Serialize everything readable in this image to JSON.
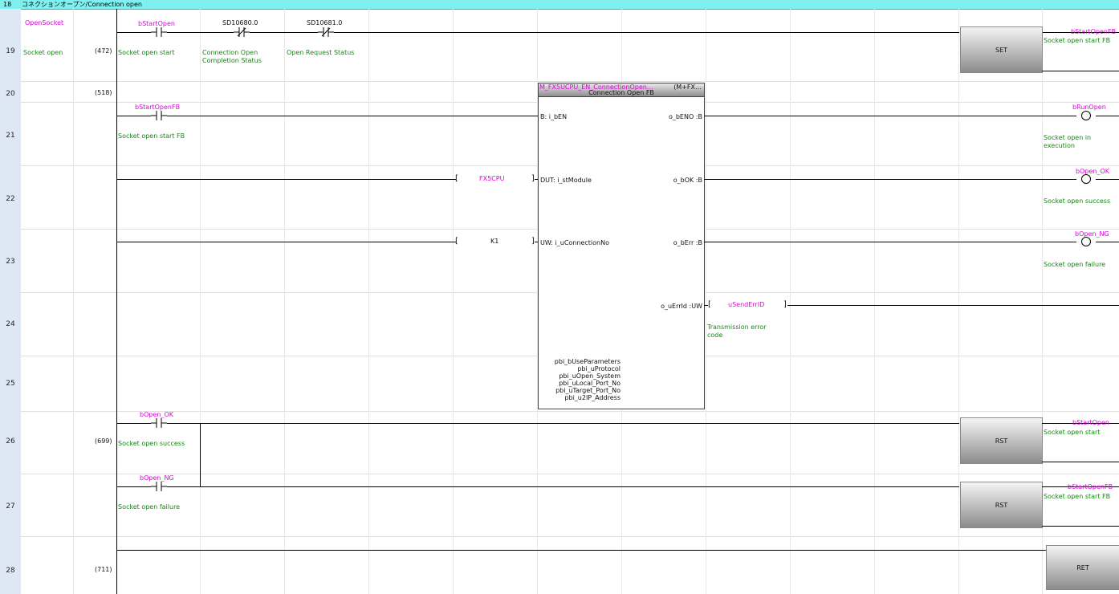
{
  "header": {
    "row_no": "18",
    "title": "コネクションオープン/Connection open"
  },
  "rows": [
    "19",
    "20",
    "21",
    "22",
    "23",
    "24",
    "25",
    "26",
    "27",
    "28"
  ],
  "statements": {
    "label": "OpenSocket",
    "comment": "Socket open"
  },
  "steps": {
    "s472": "(472)",
    "s518": "(518)",
    "s699": "(699)",
    "s711": "(711)"
  },
  "contacts": {
    "bStartOpen": {
      "device": "bStartOpen",
      "comment": "Socket open start"
    },
    "sd10680": {
      "device": "SD10680.0",
      "comment_line1": "Connection Open",
      "comment_line2": "Completion Status"
    },
    "sd10681": {
      "device": "SD10681.0",
      "comment": "Open Request Status"
    },
    "bStartOpenFB": {
      "device": "bStartOpenFB",
      "comment": "Socket open start FB"
    },
    "bOpenOK": {
      "device": "bOpen_OK",
      "comment": "Socket open success"
    },
    "bOpenNG": {
      "device": "bOpen_NG",
      "comment": "Socket open failure"
    }
  },
  "coils": {
    "set1": {
      "instr": "SET",
      "device": "bStartOpenFB",
      "comment": "Socket open start FB"
    },
    "bRunOpen": {
      "device": "bRunOpen",
      "comment_line1": "Socket open in",
      "comment_line2": "execution"
    },
    "bOpenOK": {
      "device": "bOpen_OK",
      "comment": "Socket open success"
    },
    "bOpenNG": {
      "device": "bOpen_NG",
      "comment": "Socket open failure"
    },
    "rst1": {
      "instr": "RST",
      "device": "bStartOpen",
      "comment": "Socket open start"
    },
    "rst2": {
      "instr": "RST",
      "device": "bStartOpenFB",
      "comment": "Socket open start FB"
    },
    "ret": {
      "instr": "RET"
    }
  },
  "fb": {
    "name": "M_FX5UCPU_EN_ConnectionOpen…",
    "type": "(M+FX…",
    "title": "Connection Open FB",
    "in_en": "B: i_bEN",
    "in_module": "DUT: i_stModule",
    "in_conn": "UW: i_uConnectionNo",
    "out_eno": "o_bENO :B",
    "out_ok": "o_bOK :B",
    "out_err": "o_bErr :B",
    "out_errid": "o_uErrId :UW",
    "params": [
      "pbi_bUseParameters",
      "pbi_uProtocol",
      "pbi_uOpen_System",
      "pbi_uLocal_Port_No",
      "pbi_uTarget_Port_No",
      "pbi_u2IP_Address"
    ]
  },
  "operands": {
    "module": "FX5CPU",
    "conn": "K1",
    "errid": "uSendErrID",
    "errid_comment_line1": "Transmission error",
    "errid_comment_line2": "code"
  }
}
